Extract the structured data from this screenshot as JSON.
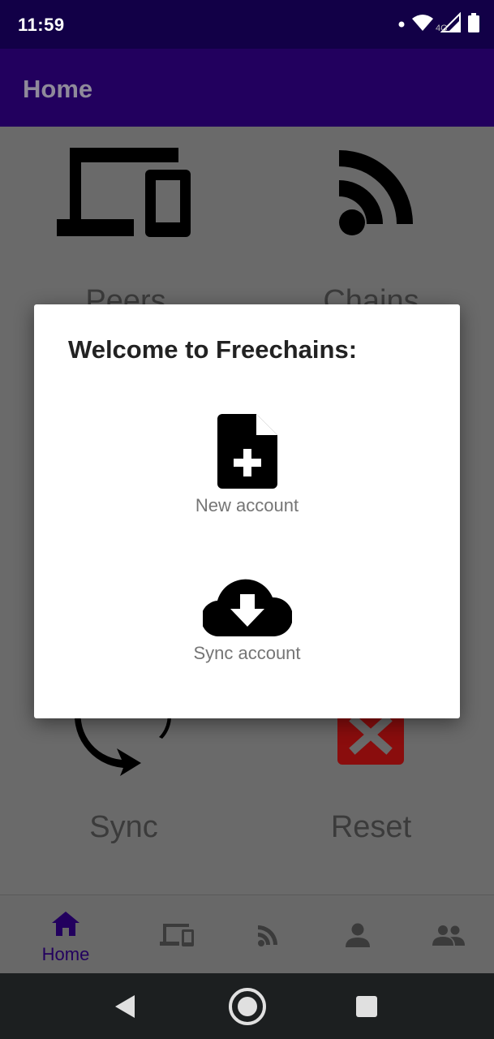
{
  "status_bar": {
    "time": "11:59",
    "network": "4G"
  },
  "app_bar": {
    "title": "Home"
  },
  "grid": [
    {
      "label": "Peers",
      "icon": "devices-icon"
    },
    {
      "label": "Chains",
      "icon": "rss-feed-icon"
    },
    {
      "label": "Sync",
      "icon": "sync-icon"
    },
    {
      "label": "Reset",
      "icon": "reset-icon"
    }
  ],
  "dialog": {
    "title": "Welcome to Freechains:",
    "options": [
      {
        "label": "New account",
        "icon": "note-add-icon"
      },
      {
        "label": "Sync account",
        "icon": "cloud-download-icon"
      }
    ]
  },
  "bottom_nav": {
    "items": [
      {
        "label": "Home",
        "icon": "home-icon",
        "active": true
      },
      {
        "label": "",
        "icon": "devices-icon"
      },
      {
        "label": "",
        "icon": "rss-feed-icon"
      },
      {
        "label": "",
        "icon": "person-icon"
      },
      {
        "label": "",
        "icon": "people-icon"
      }
    ]
  },
  "colors": {
    "status_bar": "#120047",
    "app_bar": "#22005e",
    "accent": "#22005e",
    "reset_red": "#8a0d0d",
    "scrim": "#6a6a6a"
  }
}
